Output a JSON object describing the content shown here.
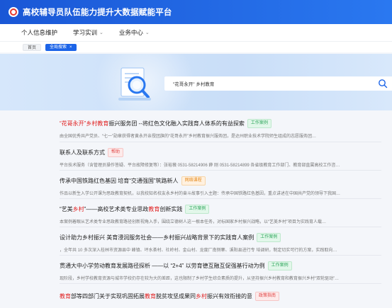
{
  "header": {
    "title": "高校辅导员队伍能力提升大数据赋能平台",
    "accent": "#1a57d6"
  },
  "nav": {
    "items": [
      {
        "label": "个人信息维护",
        "has_dropdown": false
      },
      {
        "label": "学习实训",
        "has_dropdown": true
      },
      {
        "label": "业务中心",
        "has_dropdown": true
      }
    ]
  },
  "tabs": {
    "home": "首页",
    "active": "全局搜索",
    "close": "×"
  },
  "search": {
    "query": "\"花哥永开\" 乡村教育"
  },
  "results": [
    {
      "title_segments": [
        {
          "t": "“花哥永开” ",
          "hl": true
        },
        {
          "t": "乡村教育",
          "hl": true
        },
        {
          "t": "振兴服务团 --将红色文化融入实践育人体系的有益探索",
          "hl": false
        }
      ],
      "badge": "工作案例",
      "badge_color": "green",
      "snippet": "由全国优秀共产党员、“七一”勋章获得者黄永开亲授团旗的“花哥永开”乡村教育振兴服务团，是达州职业技术学院师生组成的志愿服务团…"
    },
    {
      "title_segments": [
        {
          "t": "联系人及联系方式",
          "hl": false
        }
      ],
      "badge": "帮助",
      "badge_color": "red",
      "snippet": "平台技术服务（含管理员操作答疑、平台故障修复等）：张裕薇 0531-58214906 薛 刚 0531-58214899 各省级教育工作部门、教育部直属高校工作咨…"
    },
    {
      "title_segments": [
        {
          "t": "传承中国铁路红色基因 培育“交通强国”筑路新人",
          "hl": false
        }
      ],
      "badge": "网络课程",
      "badge_color": "orange",
      "snippet": "作品以新生入学公开课为思政教育契机，以我校知名校友永乡村的奋斗故事引入主题：传承中国铁路红色基因，重点讲述在中国共产党的领导下我国…"
    },
    {
      "title_segments": [
        {
          "t": "“艺美",
          "hl": false
        },
        {
          "t": "乡村",
          "hl": true
        },
        {
          "t": "”——高校艺术类专业思政",
          "hl": false
        },
        {
          "t": "教育",
          "hl": true
        },
        {
          "t": "创新实践",
          "hl": false
        }
      ],
      "badge": "工作案例",
      "badge_color": "green",
      "snippet": "本案例着眼从艺术类专业思政教育路径创新视角入手，围绕立德树人这一根本任务，对标国家乡村振兴战略，以“艺美乡村”项目为实践育人载…"
    },
    {
      "title_segments": [
        {
          "t": "设计助力乡村振兴 美育浸润服务社会——乡村振兴战略背景下的实践育人案例",
          "hl": false
        }
      ],
      "badge": "工作案例",
      "badge_color": "green",
      "snippet": "，全年共 10 多次深入桂林市资源县中 峰镇、坪水茶村、社岭村、金山村、龙度厂南侧寨、溪阳县进行专 培调研，制定切实可行的方案，实践取向…"
    },
    {
      "title_segments": [
        {
          "t": "贯通大中小学劳动教育发展路径探析 ——以 “2+4” 以劳育德互融互促强基行动为例",
          "hl": false
        }
      ],
      "badge": "工作案例",
      "badge_color": "green",
      "snippet": "现阶段，乡村学校教育资源与城市学校仍存在较为大的差距，这也限制了乡村学生综合素质的提升，从坚持振兴乡村教育和教育振兴乡村“双轮驱动”…"
    },
    {
      "title_segments": [
        {
          "t": "教育",
          "hl": true
        },
        {
          "t": "部等四部门关于实现巩固拓展",
          "hl": false
        },
        {
          "t": "教育",
          "hl": true
        },
        {
          "t": "脱贫攻坚成果同",
          "hl": false
        },
        {
          "t": "乡村",
          "hl": true
        },
        {
          "t": "振兴有效衔接的意",
          "hl": false
        }
      ],
      "badge": "政策指南",
      "badge_color": "red",
      "snippet": ""
    }
  ]
}
